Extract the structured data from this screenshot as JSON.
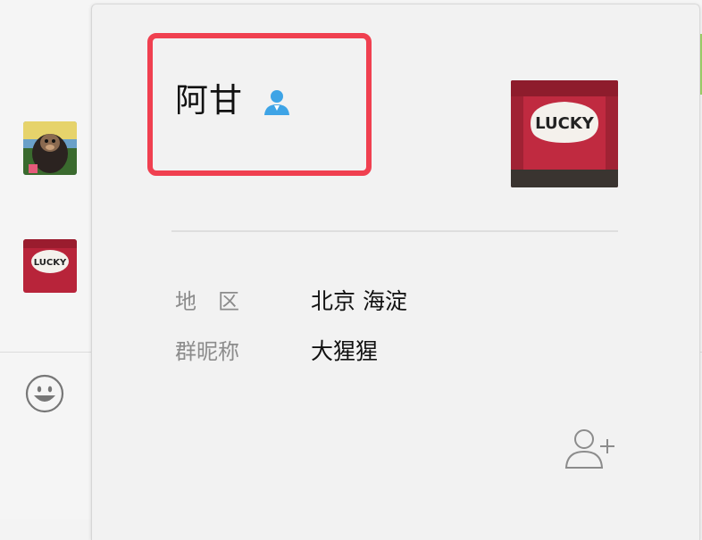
{
  "profile": {
    "name": "阿甘",
    "region_label": "地区",
    "region_value": "北京 海淀",
    "nickname_label": "群昵称",
    "nickname_value": "大猩猩",
    "photo_text": "LUCKY"
  },
  "icons": {
    "contact": "person-icon",
    "add_contact": "add-contact-icon",
    "emoji": "smiley-icon"
  },
  "colors": {
    "highlight": "#f04050",
    "contact_icon": "#3ea4e6",
    "shirt_red": "#b8243a"
  }
}
